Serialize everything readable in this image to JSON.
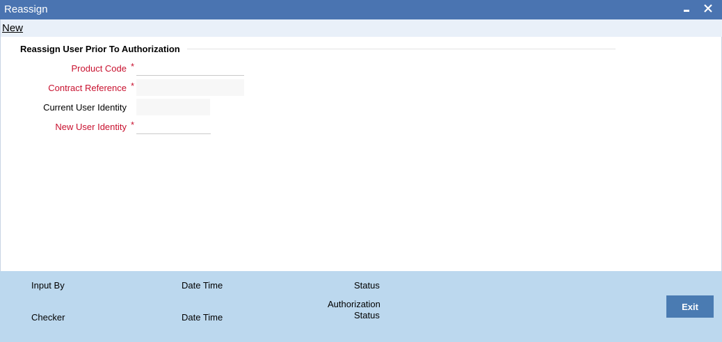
{
  "window": {
    "title": "Reassign"
  },
  "toolbar": {
    "new_label": "New"
  },
  "form": {
    "section_title": "Reassign User Prior To Authorization",
    "fields": [
      {
        "label": "Product Code",
        "required": true,
        "value": ""
      },
      {
        "label": "Contract Reference",
        "required": true,
        "value": ""
      },
      {
        "label": "Current User Identity",
        "required": false,
        "value": ""
      },
      {
        "label": "New User Identity",
        "required": true,
        "value": ""
      }
    ],
    "required_marker": "*"
  },
  "footer": {
    "input_by_label": "Input By",
    "date_time_label_1": "Date Time",
    "status_label": "Status",
    "checker_label": "Checker",
    "date_time_label_2": "Date Time",
    "authorization_label": "Authorization",
    "authorization_status_label": "Status",
    "exit_label": "Exit"
  },
  "colors": {
    "titlebar": "#4a74b1",
    "toolbar": "#e9f0f9",
    "footer": "#bcd8ee",
    "required_label": "#c8102e",
    "exit_button": "#4a7bb2"
  }
}
